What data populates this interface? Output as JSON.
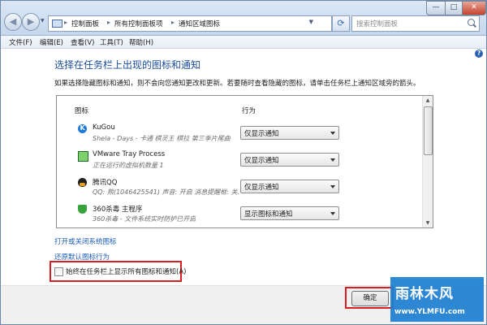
{
  "window": {
    "title_controls": {
      "minimize": "—",
      "maximize": "□",
      "close": "✕"
    }
  },
  "address_bar": {
    "breadcrumbs": [
      "控制面板",
      "所有控制面板项",
      "通知区域图标"
    ],
    "separator": "▸",
    "refresh": "⟳"
  },
  "search": {
    "placeholder": "搜索控制面板"
  },
  "menu": {
    "items": [
      "文件(F)",
      "编辑(E)",
      "查看(V)",
      "工具(T)",
      "帮助(H)"
    ]
  },
  "main": {
    "heading": "选择在任务栏上出现的图标和通知",
    "description": "如果选择隐藏图标和通知，则不会向您通知更改和更新。若要随时查看隐藏的图标，请单击任务栏上通知区域旁的箭头。",
    "columns": {
      "icon": "图标",
      "behavior": "行为"
    },
    "rows": [
      {
        "icon": "kugou-icon",
        "name": "KuGou",
        "subtitle": "Shela - Days - 卡通 棋灵王 棋拉 第三季片尾曲",
        "behavior": "仅显示通知"
      },
      {
        "icon": "vmware-icon",
        "name": "VMware Tray Process",
        "subtitle": "正在运行的虚拟机数量 1",
        "behavior": "仅显示通知"
      },
      {
        "icon": "qq-icon",
        "name": "腾讯QQ",
        "subtitle": "QQ: 熊(1046425541) 声音: 开启 消息提醒框: 关...",
        "behavior": "仅显示通知"
      },
      {
        "icon": "360-shield-icon",
        "name": "360杀毒 主程序",
        "subtitle": "360杀毒 - 文件系统实时防护已开启",
        "behavior": "显示图标和通知"
      }
    ],
    "link_system_icons": "打开或关闭系统图标",
    "link_restore": "还原默认图标行为",
    "checkbox_label": "始终在任务栏上显示所有图标和通知(A)",
    "checkbox_checked": false
  },
  "footer": {
    "ok_label": "确定"
  },
  "watermark": {
    "title": "雨林木风",
    "url": "www.YLMFU.com"
  },
  "colors": {
    "accent": "#1b4d9a",
    "link": "#1a5bb8",
    "highlight_box": "#d71f23",
    "watermark": "#1d7fd0"
  }
}
